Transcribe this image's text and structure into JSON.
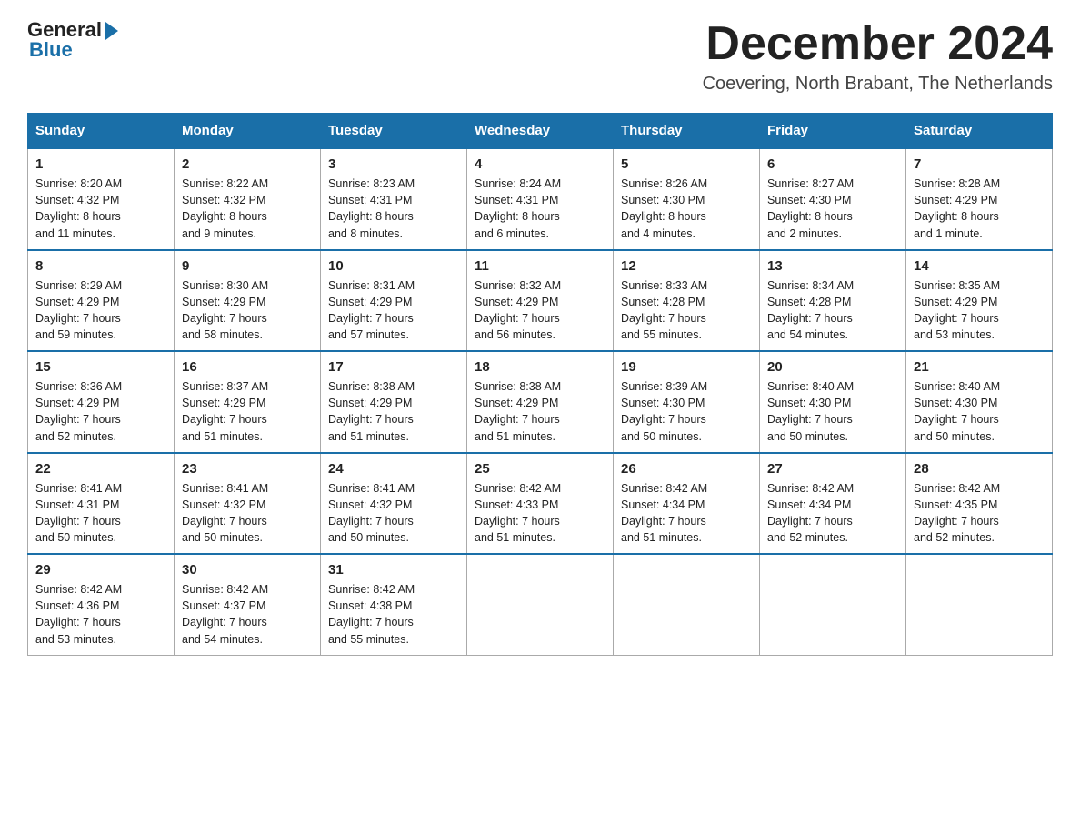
{
  "header": {
    "logo_general": "General",
    "logo_blue": "Blue",
    "month_title": "December 2024",
    "location": "Coevering, North Brabant, The Netherlands"
  },
  "days_of_week": [
    "Sunday",
    "Monday",
    "Tuesday",
    "Wednesday",
    "Thursday",
    "Friday",
    "Saturday"
  ],
  "weeks": [
    [
      {
        "day": "1",
        "sunrise": "8:20 AM",
        "sunset": "4:32 PM",
        "daylight": "8 hours and 11 minutes."
      },
      {
        "day": "2",
        "sunrise": "8:22 AM",
        "sunset": "4:32 PM",
        "daylight": "8 hours and 9 minutes."
      },
      {
        "day": "3",
        "sunrise": "8:23 AM",
        "sunset": "4:31 PM",
        "daylight": "8 hours and 8 minutes."
      },
      {
        "day": "4",
        "sunrise": "8:24 AM",
        "sunset": "4:31 PM",
        "daylight": "8 hours and 6 minutes."
      },
      {
        "day": "5",
        "sunrise": "8:26 AM",
        "sunset": "4:30 PM",
        "daylight": "8 hours and 4 minutes."
      },
      {
        "day": "6",
        "sunrise": "8:27 AM",
        "sunset": "4:30 PM",
        "daylight": "8 hours and 2 minutes."
      },
      {
        "day": "7",
        "sunrise": "8:28 AM",
        "sunset": "4:29 PM",
        "daylight": "8 hours and 1 minute."
      }
    ],
    [
      {
        "day": "8",
        "sunrise": "8:29 AM",
        "sunset": "4:29 PM",
        "daylight": "7 hours and 59 minutes."
      },
      {
        "day": "9",
        "sunrise": "8:30 AM",
        "sunset": "4:29 PM",
        "daylight": "7 hours and 58 minutes."
      },
      {
        "day": "10",
        "sunrise": "8:31 AM",
        "sunset": "4:29 PM",
        "daylight": "7 hours and 57 minutes."
      },
      {
        "day": "11",
        "sunrise": "8:32 AM",
        "sunset": "4:29 PM",
        "daylight": "7 hours and 56 minutes."
      },
      {
        "day": "12",
        "sunrise": "8:33 AM",
        "sunset": "4:28 PM",
        "daylight": "7 hours and 55 minutes."
      },
      {
        "day": "13",
        "sunrise": "8:34 AM",
        "sunset": "4:28 PM",
        "daylight": "7 hours and 54 minutes."
      },
      {
        "day": "14",
        "sunrise": "8:35 AM",
        "sunset": "4:29 PM",
        "daylight": "7 hours and 53 minutes."
      }
    ],
    [
      {
        "day": "15",
        "sunrise": "8:36 AM",
        "sunset": "4:29 PM",
        "daylight": "7 hours and 52 minutes."
      },
      {
        "day": "16",
        "sunrise": "8:37 AM",
        "sunset": "4:29 PM",
        "daylight": "7 hours and 51 minutes."
      },
      {
        "day": "17",
        "sunrise": "8:38 AM",
        "sunset": "4:29 PM",
        "daylight": "7 hours and 51 minutes."
      },
      {
        "day": "18",
        "sunrise": "8:38 AM",
        "sunset": "4:29 PM",
        "daylight": "7 hours and 51 minutes."
      },
      {
        "day": "19",
        "sunrise": "8:39 AM",
        "sunset": "4:30 PM",
        "daylight": "7 hours and 50 minutes."
      },
      {
        "day": "20",
        "sunrise": "8:40 AM",
        "sunset": "4:30 PM",
        "daylight": "7 hours and 50 minutes."
      },
      {
        "day": "21",
        "sunrise": "8:40 AM",
        "sunset": "4:30 PM",
        "daylight": "7 hours and 50 minutes."
      }
    ],
    [
      {
        "day": "22",
        "sunrise": "8:41 AM",
        "sunset": "4:31 PM",
        "daylight": "7 hours and 50 minutes."
      },
      {
        "day": "23",
        "sunrise": "8:41 AM",
        "sunset": "4:32 PM",
        "daylight": "7 hours and 50 minutes."
      },
      {
        "day": "24",
        "sunrise": "8:41 AM",
        "sunset": "4:32 PM",
        "daylight": "7 hours and 50 minutes."
      },
      {
        "day": "25",
        "sunrise": "8:42 AM",
        "sunset": "4:33 PM",
        "daylight": "7 hours and 51 minutes."
      },
      {
        "day": "26",
        "sunrise": "8:42 AM",
        "sunset": "4:34 PM",
        "daylight": "7 hours and 51 minutes."
      },
      {
        "day": "27",
        "sunrise": "8:42 AM",
        "sunset": "4:34 PM",
        "daylight": "7 hours and 52 minutes."
      },
      {
        "day": "28",
        "sunrise": "8:42 AM",
        "sunset": "4:35 PM",
        "daylight": "7 hours and 52 minutes."
      }
    ],
    [
      {
        "day": "29",
        "sunrise": "8:42 AM",
        "sunset": "4:36 PM",
        "daylight": "7 hours and 53 minutes."
      },
      {
        "day": "30",
        "sunrise": "8:42 AM",
        "sunset": "4:37 PM",
        "daylight": "7 hours and 54 minutes."
      },
      {
        "day": "31",
        "sunrise": "8:42 AM",
        "sunset": "4:38 PM",
        "daylight": "7 hours and 55 minutes."
      },
      null,
      null,
      null,
      null
    ]
  ],
  "labels": {
    "sunrise": "Sunrise:",
    "sunset": "Sunset:",
    "daylight": "Daylight:"
  }
}
